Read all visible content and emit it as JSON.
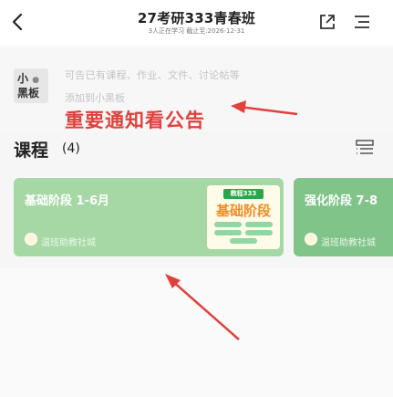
{
  "header": {
    "title": "27考研333青春班",
    "subtitle": "3人正在学习 截止至:2026-12-31"
  },
  "board": {
    "badge_line1": "小",
    "badge_line2": "黑板",
    "text_line1": "可告已有课程、作业、文件、讨论帖等",
    "text_line2": "添加到小黑板",
    "notice": "重要通知看公告"
  },
  "courses": {
    "heading": "课程",
    "count": "(4)",
    "items": [
      {
        "title": "基础阶段 1-6月",
        "teacher": "温班助教社城",
        "cover_tag": "教程333",
        "cover_title": "基础阶段"
      },
      {
        "title": "强化阶段 7-8",
        "teacher": "温班助教社城"
      }
    ]
  },
  "colors": {
    "annotation_red": "#e0413d",
    "card_green_1": "#a6d8a6",
    "card_green_2": "#80c48a"
  }
}
